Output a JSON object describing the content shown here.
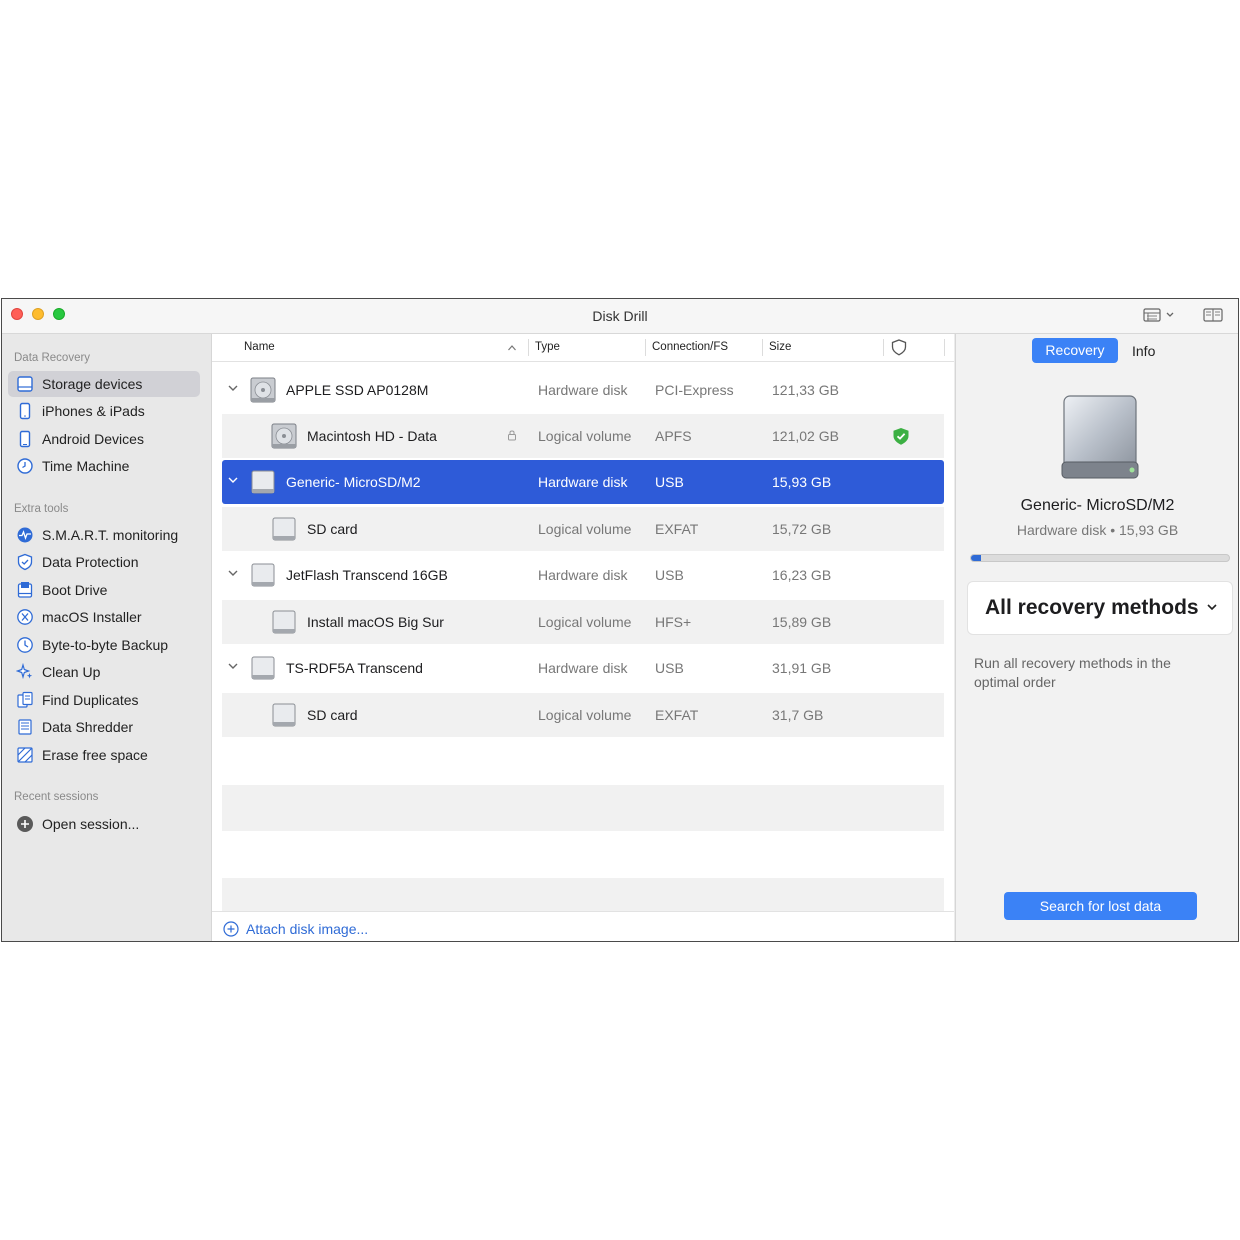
{
  "window": {
    "title": "Disk Drill"
  },
  "sidebar": {
    "sections": [
      {
        "title": "Data Recovery",
        "items": [
          {
            "label": "Storage devices",
            "icon": "drive-icon",
            "active": true
          },
          {
            "label": "iPhones & iPads",
            "icon": "iphone-icon"
          },
          {
            "label": "Android Devices",
            "icon": "android-icon"
          },
          {
            "label": "Time Machine",
            "icon": "time-machine-icon"
          }
        ]
      },
      {
        "title": "Extra tools",
        "items": [
          {
            "label": "S.M.A.R.T. monitoring",
            "icon": "smart-monitor-icon"
          },
          {
            "label": "Data Protection",
            "icon": "shield-icon"
          },
          {
            "label": "Boot Drive",
            "icon": "boot-drive-icon"
          },
          {
            "label": "macOS Installer",
            "icon": "macos-installer-icon"
          },
          {
            "label": "Byte-to-byte Backup",
            "icon": "backup-icon"
          },
          {
            "label": "Clean Up",
            "icon": "sparkle-icon"
          },
          {
            "label": "Find Duplicates",
            "icon": "duplicates-icon"
          },
          {
            "label": "Data Shredder",
            "icon": "shredder-icon"
          },
          {
            "label": "Erase free space",
            "icon": "erase-icon"
          }
        ]
      },
      {
        "title": "Recent sessions",
        "items": [
          {
            "label": "Open session...",
            "icon": "plus-circle-icon"
          }
        ]
      }
    ]
  },
  "table": {
    "columns": {
      "name": "Name",
      "type": "Type",
      "connection": "Connection/FS",
      "size": "Size"
    },
    "rows": [
      {
        "name": "APPLE SSD AP0128M",
        "type": "Hardware disk",
        "connection": "PCI-Express",
        "size": "121,33 GB",
        "level": 0
      },
      {
        "name": "Macintosh HD - Data",
        "type": "Logical volume",
        "connection": "APFS",
        "size": "121,02 GB",
        "level": 1,
        "locked": true,
        "protected": true
      },
      {
        "name": "Generic- MicroSD/M2",
        "type": "Hardware disk",
        "connection": "USB",
        "size": "15,93 GB",
        "level": 0,
        "selected": true
      },
      {
        "name": "SD card",
        "type": "Logical volume",
        "connection": "EXFAT",
        "size": "15,72 GB",
        "level": 1
      },
      {
        "name": "JetFlash Transcend 16GB",
        "type": "Hardware disk",
        "connection": "USB",
        "size": "16,23 GB",
        "level": 0
      },
      {
        "name": "Install macOS Big Sur",
        "type": "Logical volume",
        "connection": "HFS+",
        "size": "15,89 GB",
        "level": 1
      },
      {
        "name": "TS-RDF5A Transcend",
        "type": "Hardware disk",
        "connection": "USB",
        "size": "31,91 GB",
        "level": 0
      },
      {
        "name": "SD card",
        "type": "Logical volume",
        "connection": "EXFAT",
        "size": "31,7 GB",
        "level": 1
      }
    ],
    "attach_label": "Attach disk image..."
  },
  "panel": {
    "tabs": {
      "recovery": "Recovery",
      "info": "Info"
    },
    "device_name": "Generic- MicroSD/M2",
    "device_sub": "Hardware disk • 15,93 GB",
    "progress": 0.04,
    "method": "All recovery methods",
    "method_desc": "Run all recovery methods in the optimal order",
    "search_button": "Search for lost data"
  },
  "colors": {
    "accent": "#3b82f6",
    "selection": "#2e5bd8",
    "protected": "#3cb043"
  }
}
